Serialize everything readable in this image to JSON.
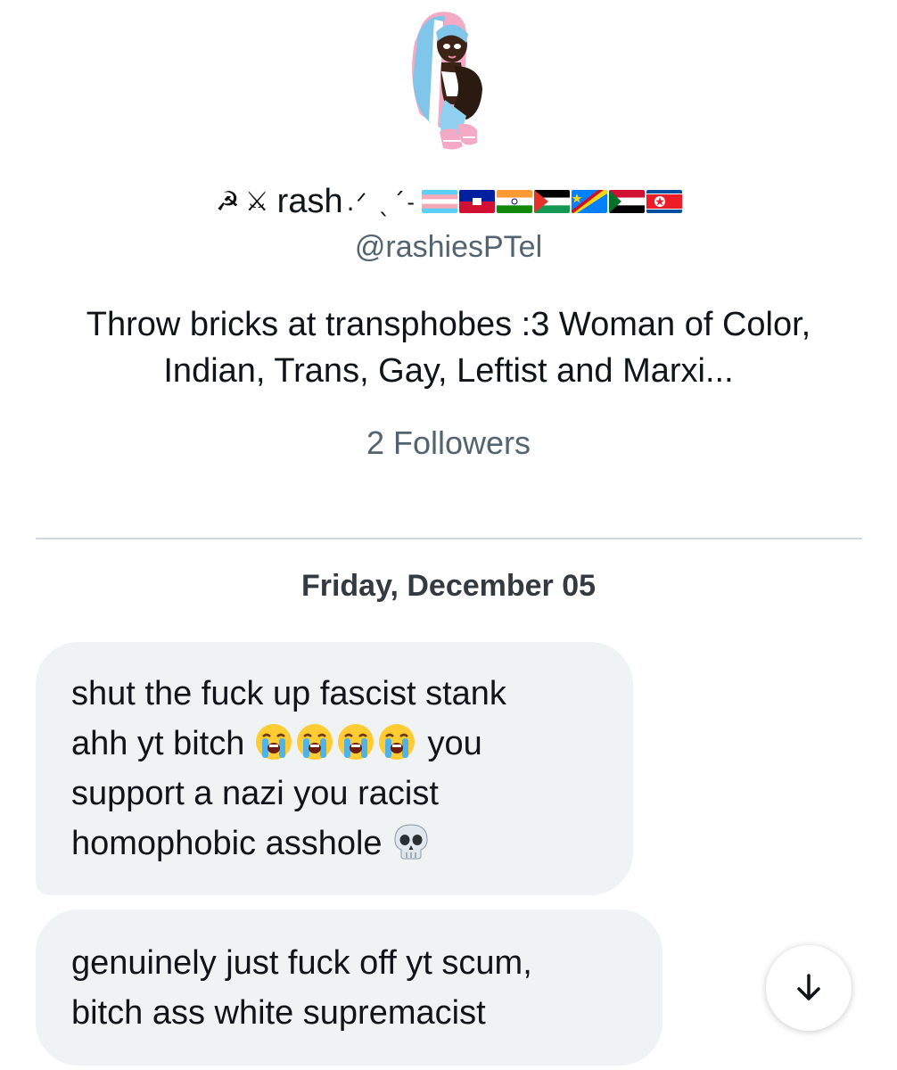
{
  "profile": {
    "name": "rash",
    "name_decoration": ".ᐟ ˎˊ˗",
    "name_icons": [
      "hammer-sickle-icon",
      "crossed-swords-icon"
    ],
    "name_flags": [
      "transgender-flag",
      "haiti-flag",
      "india-flag",
      "palestine-flag",
      "dr-congo-flag",
      "sudan-flag",
      "north-korea-flag"
    ],
    "handle": "@rashiesPTel",
    "bio": "Throw bricks at transphobes :3 Woman of Color, Indian, Trans, Gay, Leftist and Marxi...",
    "followers": "2 Followers"
  },
  "conversation": {
    "date": "Friday, December 05",
    "messages": [
      {
        "line1": "shut the fuck up fascist stank",
        "line2_start": "ahh yt bitch",
        "line2_emojis": [
          "loudly-crying-face-emoji",
          "loudly-crying-face-emoji",
          "loudly-crying-face-emoji",
          "loudly-crying-face-emoji"
        ],
        "line2_end": "you",
        "line3": "support a nazi you racist",
        "line4": "homophobic asshole",
        "line4_emoji": "skull-emoji"
      },
      {
        "line1": "genuinely just fuck off yt scum,",
        "line2": "bitch ass white supremacist"
      }
    ]
  },
  "controls": {
    "scroll_icon": "arrow-down-icon"
  },
  "colors": {
    "text_primary": "#0f1419",
    "text_secondary": "#536471",
    "bubble_bg": "#eff3f4",
    "divider": "#cfd9de"
  }
}
